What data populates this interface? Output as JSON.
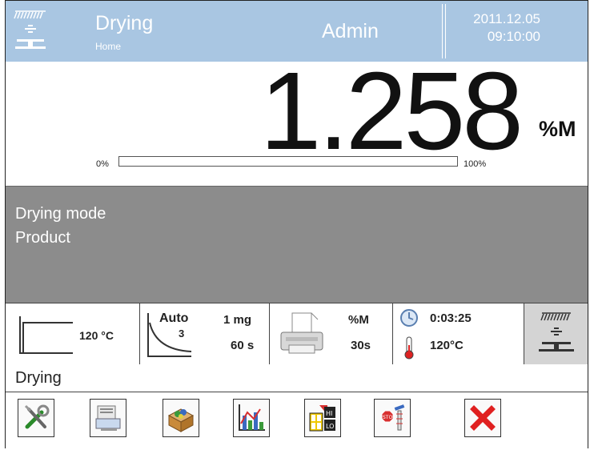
{
  "header": {
    "title": "Drying",
    "subtitle": "Home",
    "user": "Admin",
    "date": "2011.12.05",
    "time": "09:10:00"
  },
  "result": {
    "value": "1.258",
    "unit": "%M",
    "progress_min": "0%",
    "progress_max": "100%",
    "progress_fraction": 0.0
  },
  "info": {
    "line1": "Drying mode",
    "line2": "Product"
  },
  "params": {
    "temp_profile": "120 °C",
    "mode": "Auto",
    "mode_num": "3",
    "mode_mass": "1 mg",
    "mode_time": "60 s",
    "print_unit": "%M",
    "print_interval": "30s",
    "elapsed": "0:03:25",
    "current_temp": "120°C"
  },
  "status": {
    "label": "Drying"
  },
  "toolbar": {
    "buttons": [
      "settings",
      "database",
      "products",
      "chart",
      "thresholds",
      "stop-criteria",
      "cancel"
    ]
  },
  "colors": {
    "header_bg": "#a9c6e2",
    "info_bg": "#8c8c8c",
    "cancel": "#e02020"
  }
}
